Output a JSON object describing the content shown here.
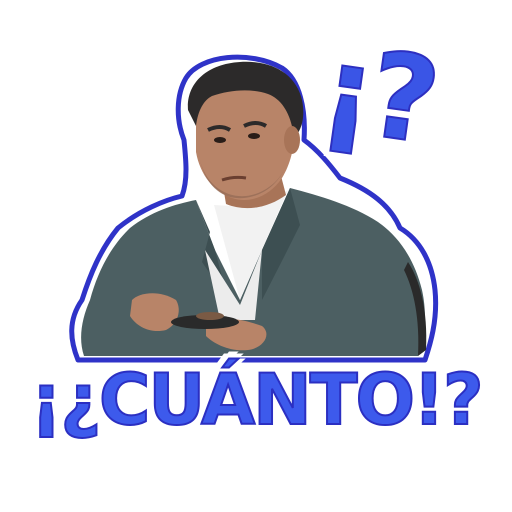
{
  "sticker": {
    "caption": "¡¿CUÁNTO!?",
    "top_punctuation": "¡?"
  },
  "colors": {
    "text_fill": "#3d5aec",
    "text_stroke": "#2b2fc2",
    "outline": "#2f33c8",
    "jacket": "#4c5f62",
    "shirt": "#f2f2f2",
    "skin": "#b88468",
    "hair": "#2c2a2a"
  }
}
